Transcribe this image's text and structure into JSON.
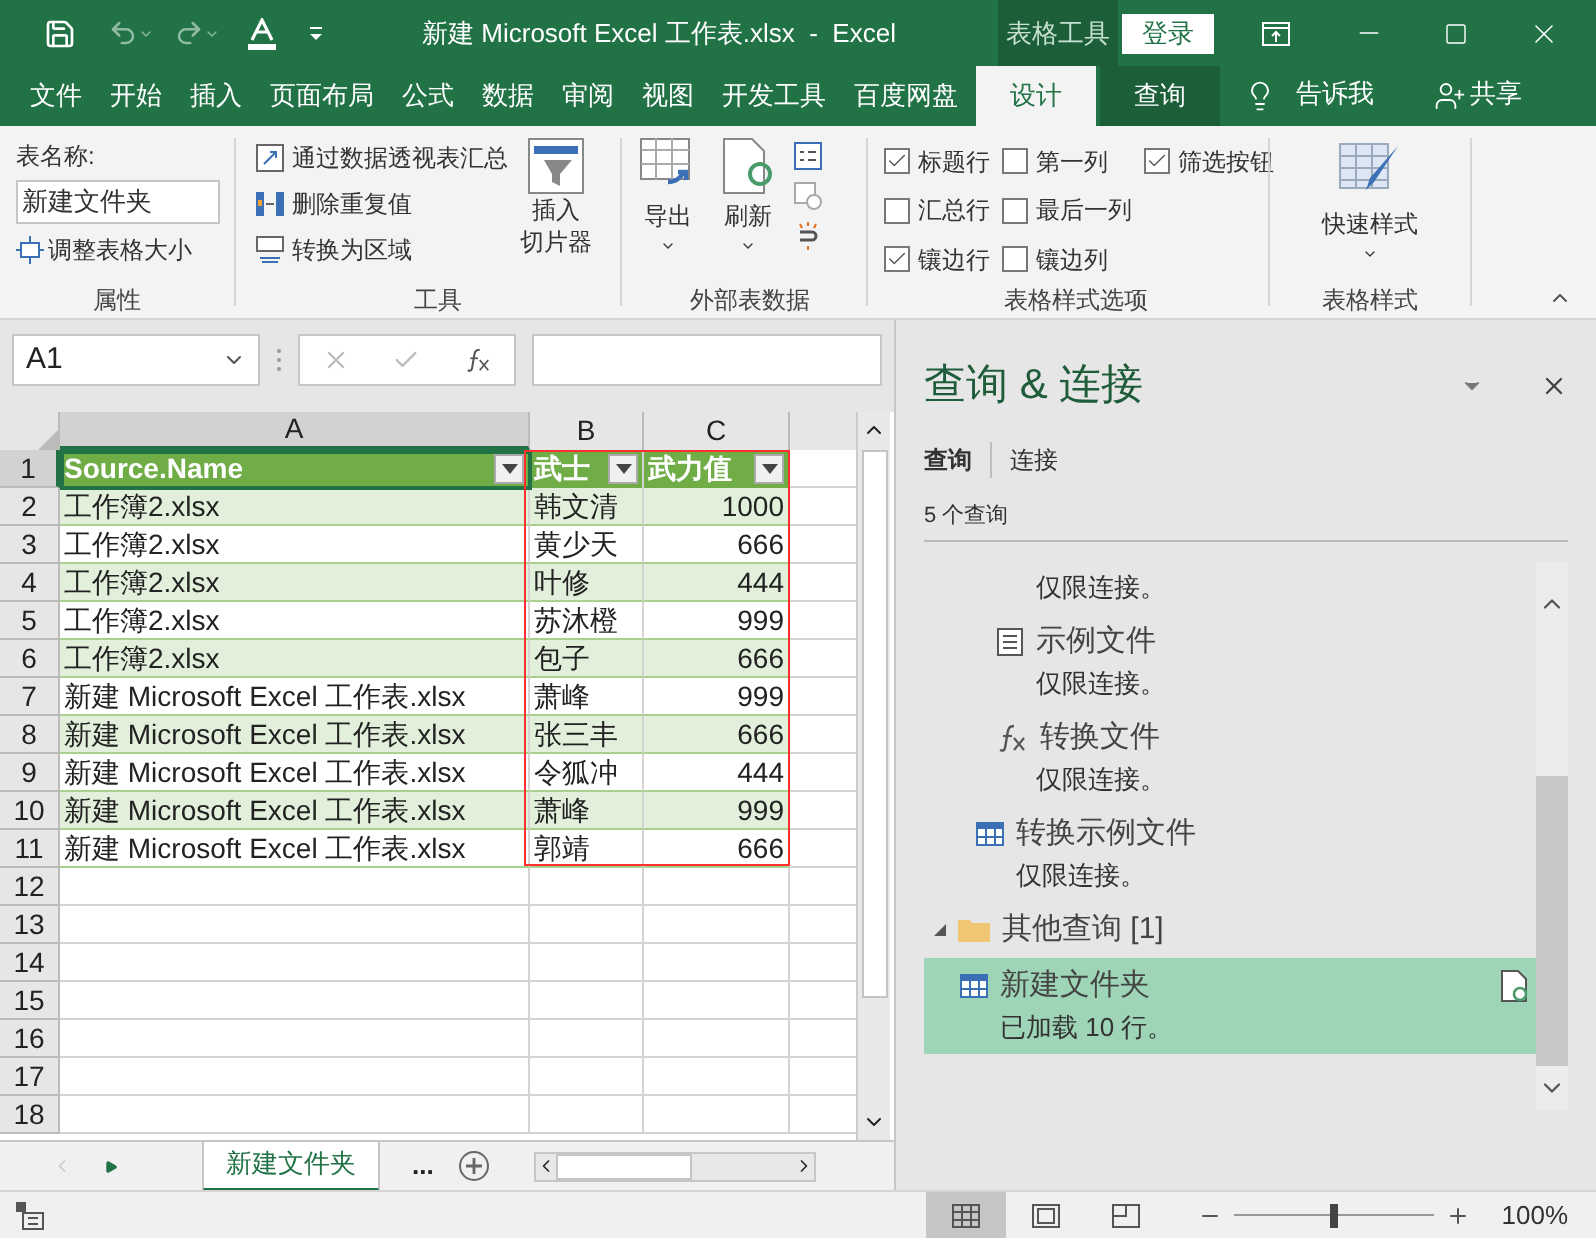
{
  "title_bar": {
    "document_title": "新建 Microsoft Excel 工作表.xlsx  -  Excel",
    "context_group": "表格工具",
    "sign_in": "登录"
  },
  "ribbon_tabs": [
    {
      "label": "文件",
      "selected": false,
      "kind": "normal"
    },
    {
      "label": "开始",
      "selected": false,
      "kind": "normal"
    },
    {
      "label": "插入",
      "selected": false,
      "kind": "normal"
    },
    {
      "label": "页面布局",
      "selected": false,
      "kind": "normal"
    },
    {
      "label": "公式",
      "selected": false,
      "kind": "normal"
    },
    {
      "label": "数据",
      "selected": false,
      "kind": "normal"
    },
    {
      "label": "审阅",
      "selected": false,
      "kind": "normal"
    },
    {
      "label": "视图",
      "selected": false,
      "kind": "normal"
    },
    {
      "label": "开发工具",
      "selected": false,
      "kind": "normal"
    },
    {
      "label": "百度网盘",
      "selected": false,
      "kind": "normal"
    },
    {
      "label": "设计",
      "selected": true,
      "kind": "contextual"
    },
    {
      "label": "查询",
      "selected": false,
      "kind": "contextual"
    }
  ],
  "tell_me": "告诉我",
  "share": "共享",
  "ribbon": {
    "properties": {
      "table_name_label": "表名称:",
      "table_name_value": "新建文件夹",
      "resize": "调整表格大小",
      "group_label": "属性"
    },
    "tools": {
      "items": [
        "通过数据透视表汇总",
        "删除重复值",
        "转换为区域"
      ],
      "slicer": [
        "插入",
        "切片器"
      ],
      "group_label": "工具"
    },
    "external": {
      "buttons": [
        "导出",
        "刷新"
      ],
      "group_label": "外部表数据"
    },
    "style_options": {
      "options": [
        {
          "label": "标题行",
          "checked": true
        },
        {
          "label": "汇总行",
          "checked": false
        },
        {
          "label": "镶边行",
          "checked": true
        },
        {
          "label": "第一列",
          "checked": false
        },
        {
          "label": "最后一列",
          "checked": false
        },
        {
          "label": "镶边列",
          "checked": false
        },
        {
          "label": "筛选按钮",
          "checked": true
        }
      ],
      "group_label": "表格样式选项"
    },
    "styles": {
      "button": "快速样式",
      "group_label": "表格样式"
    }
  },
  "formula_bar": {
    "name_box": "A1"
  },
  "sheet": {
    "columns": [
      "A",
      "B",
      "C"
    ],
    "header": [
      "Source.Name",
      "武士",
      "武力值"
    ],
    "rows": [
      [
        "工作簿2.xlsx",
        "韩文清",
        "1000"
      ],
      [
        "工作簿2.xlsx",
        "黄少天",
        "666"
      ],
      [
        "工作簿2.xlsx",
        "叶修",
        "444"
      ],
      [
        "工作簿2.xlsx",
        "苏沐橙",
        "999"
      ],
      [
        "工作簿2.xlsx",
        "包子",
        "666"
      ],
      [
        "新建 Microsoft Excel 工作表.xlsx",
        "萧峰",
        "999"
      ],
      [
        "新建 Microsoft Excel 工作表.xlsx",
        "张三丰",
        "666"
      ],
      [
        "新建 Microsoft Excel 工作表.xlsx",
        "令狐冲",
        "444"
      ],
      [
        "新建 Microsoft Excel 工作表.xlsx",
        "萧峰",
        "999"
      ],
      [
        "新建 Microsoft Excel 工作表.xlsx",
        "郭靖",
        "666"
      ]
    ],
    "row_headers": [
      "1",
      "2",
      "3",
      "4",
      "5",
      "6",
      "7",
      "8",
      "9",
      "10",
      "11",
      "12",
      "13",
      "14",
      "15",
      "16",
      "17",
      "18"
    ]
  },
  "sheet_tabs": [
    {
      "label": "新建文件夹",
      "selected": true
    }
  ],
  "more_sheets": "...",
  "pane": {
    "title": "查询 & 连接",
    "tabs": [
      {
        "label": "查询",
        "selected": true
      },
      {
        "label": "连接",
        "selected": false
      }
    ],
    "count": "5 个查询",
    "items": [
      {
        "kind": "group_tail",
        "children": [
          {
            "kind": "status_only",
            "status": "仅限连接。"
          },
          {
            "kind": "document",
            "name": "示例文件",
            "status": "仅限连接。"
          },
          {
            "kind": "function",
            "name": "转换文件",
            "status": "仅限连接。"
          }
        ]
      },
      {
        "kind": "table",
        "name": "转换示例文件",
        "status": "仅限连接。"
      },
      {
        "kind": "group",
        "label": "其他查询 [1]",
        "expanded": true,
        "children": [
          {
            "kind": "table",
            "name": "新建文件夹",
            "status": "已加载 10 行。",
            "selected": true
          }
        ]
      }
    ]
  },
  "status_bar": {
    "views": [
      {
        "kind": "normal",
        "selected": true
      },
      {
        "kind": "page_layout",
        "selected": false
      },
      {
        "kind": "page_break",
        "selected": false
      }
    ],
    "zoom": {
      "level": 0.5
    },
    "zoom_label": "100%"
  }
}
